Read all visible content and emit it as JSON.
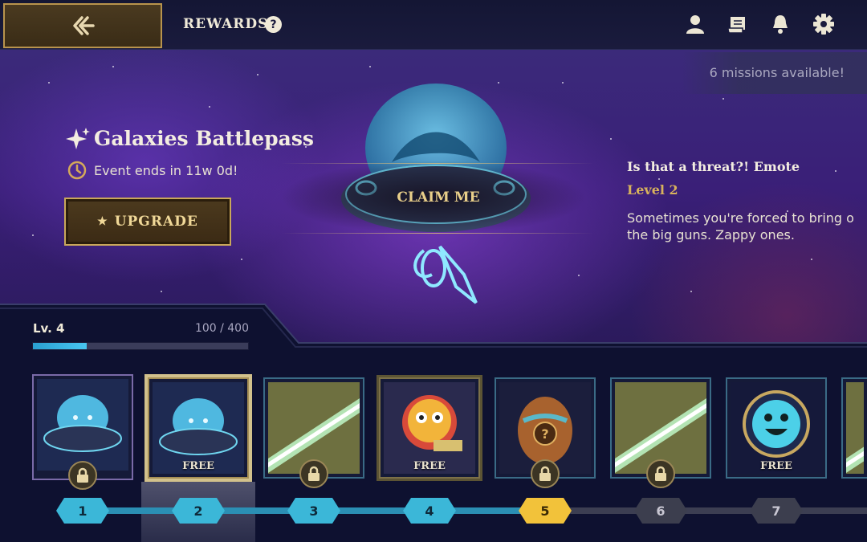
{
  "header": {
    "title": "REWARDS",
    "help_symbol": "?",
    "icons": [
      "profile-icon",
      "scroll-icon",
      "bell-icon",
      "gear-icon"
    ]
  },
  "missions": {
    "text": "6 missions available!"
  },
  "battlepass": {
    "title": "Galaxies Battlepass",
    "event_ends": "Event ends in 11w 0d!",
    "upgrade_label": "UPGRADE",
    "upgrade_star": "★"
  },
  "claim": {
    "label": "CLAIM ME"
  },
  "reward": {
    "name": "Is that a threat?! Emote",
    "level": "Level 2",
    "description": "Sometimes you're forced to bring o\nthe big guns. Zappy ones."
  },
  "progress": {
    "level_label": "Lv. 4",
    "xp_text": "100 / 400",
    "xp_current": 100,
    "xp_max": 400
  },
  "track": {
    "free_label": "FREE",
    "levels": [
      {
        "number": "1",
        "state": "done",
        "art": "ufo-icon",
        "locked": true,
        "free": false
      },
      {
        "number": "2",
        "state": "done",
        "art": "ufo-emote-icon",
        "locked": false,
        "free": true
      },
      {
        "number": "3",
        "state": "done",
        "art": "board-skin-icon",
        "locked": true,
        "free": false
      },
      {
        "number": "4",
        "state": "done",
        "art": "little-legend-icon",
        "locked": false,
        "free": true
      },
      {
        "number": "5",
        "state": "current",
        "art": "mystery-egg-icon",
        "locked": true,
        "free": false
      },
      {
        "number": "6",
        "state": "locked",
        "art": "board-skin-icon",
        "locked": true,
        "free": false
      },
      {
        "number": "7",
        "state": "locked",
        "art": "smiley-emote-icon",
        "locked": false,
        "free": true
      }
    ]
  },
  "colors": {
    "accent_gold": "#c9a75a",
    "track_blue": "#3bb7d8",
    "current_yellow": "#f2c23a"
  }
}
